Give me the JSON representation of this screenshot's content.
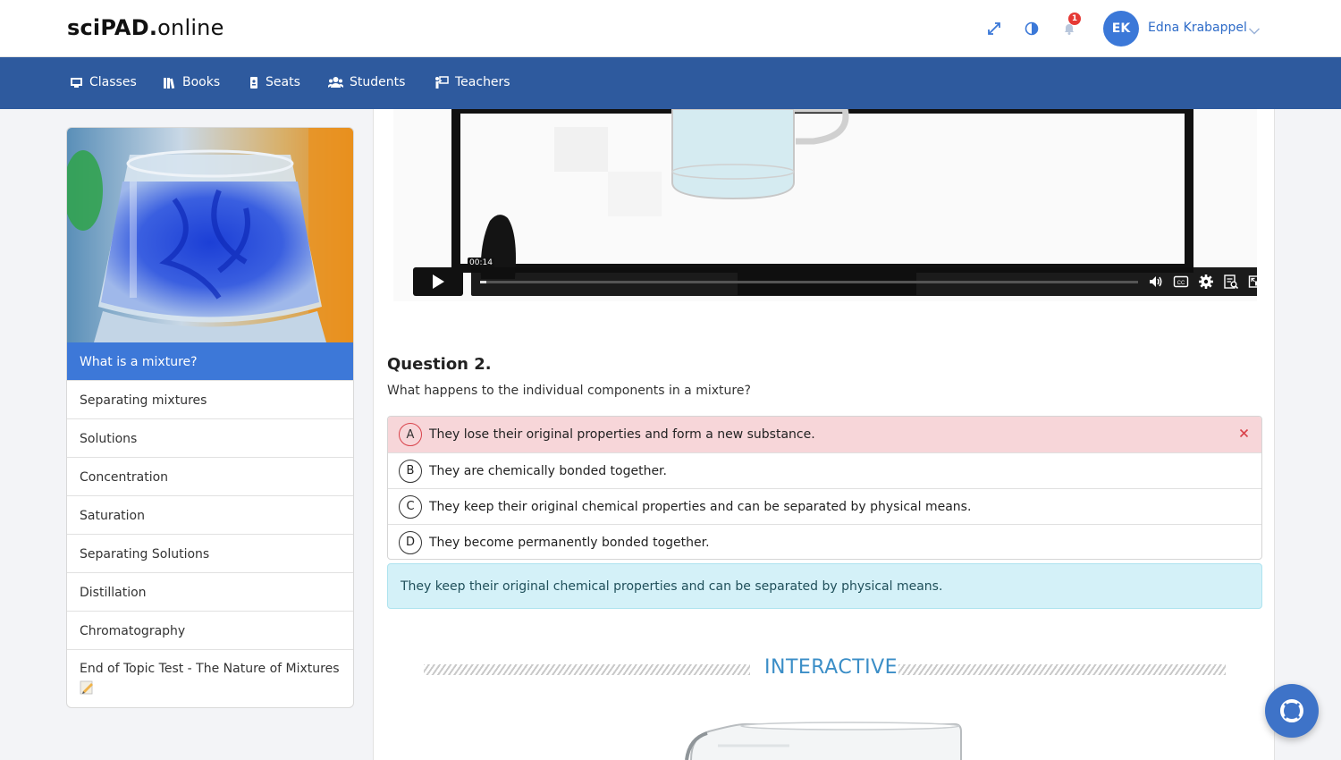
{
  "header": {
    "logo_part1": "sciPAD",
    "logo_dot": ".",
    "logo_part2": "online",
    "icons": [
      "expand-icon",
      "contrast-icon",
      "bell-icon"
    ],
    "notification_count": "1",
    "user_initials": "EK",
    "user_name": "Edna Krabappel"
  },
  "nav": {
    "items": [
      {
        "label": "Classes",
        "icon": "classes-icon"
      },
      {
        "label": "Books",
        "icon": "books-icon"
      },
      {
        "label": "Seats",
        "icon": "seats-icon"
      },
      {
        "label": "Students",
        "icon": "students-icon"
      },
      {
        "label": "Teachers",
        "icon": "teachers-icon"
      }
    ]
  },
  "sidebar": {
    "items": [
      {
        "label": "What is a mixture?",
        "active": true
      },
      {
        "label": "Separating mixtures"
      },
      {
        "label": "Solutions"
      },
      {
        "label": "Concentration"
      },
      {
        "label": "Saturation"
      },
      {
        "label": "Separating Solutions"
      },
      {
        "label": "Distillation"
      },
      {
        "label": "Chromatography"
      },
      {
        "label": "End of Topic Test - The Nature of Mixtures"
      }
    ]
  },
  "video": {
    "time": "00:14",
    "progress": 0.01,
    "controls": [
      "volume-icon",
      "captions-icon",
      "settings-icon",
      "transcript-icon",
      "pip-icon"
    ]
  },
  "question": {
    "title": "Question 2.",
    "text": "What happens to the individual components in a mixture?",
    "options": [
      {
        "letter": "A",
        "text": "They lose their original properties and form a new substance.",
        "state": "wrong"
      },
      {
        "letter": "B",
        "text": "They are chemically bonded together."
      },
      {
        "letter": "C",
        "text": "They keep their original chemical properties and can be separated by physical means."
      },
      {
        "letter": "D",
        "text": "They become permanently bonded together."
      }
    ],
    "answer": "They keep their original chemical properties and can be separated by physical means."
  },
  "section_label": "INTERACTIVE",
  "colors": {
    "brand_blue": "#2e5a9e",
    "active_blue": "#3d78d8",
    "wrong_bg": "#f7d6d9",
    "answer_bg": "#d4f1f8",
    "accent": "#3b8ec7"
  }
}
